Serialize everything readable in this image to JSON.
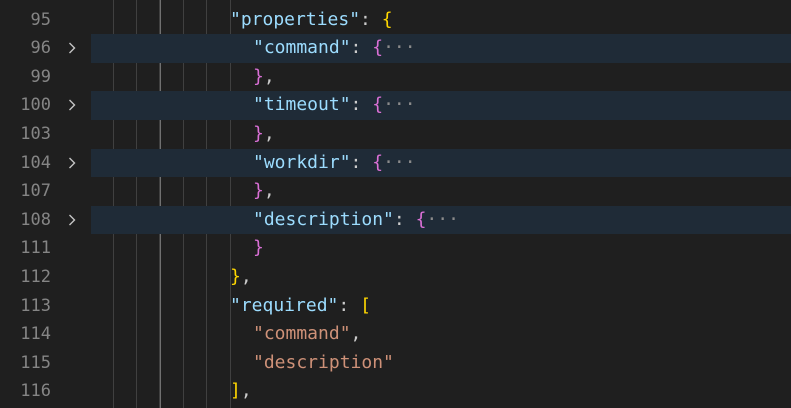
{
  "editor": {
    "lines": [
      {
        "num": "95",
        "folded": false,
        "indent": 230,
        "tokens": [
          {
            "t": "\"properties\"",
            "c": "k"
          },
          {
            "t": ": ",
            "c": "p"
          },
          {
            "t": "{",
            "c": "b1"
          }
        ]
      },
      {
        "num": "96",
        "folded": true,
        "indent": 253,
        "tokens": [
          {
            "t": "\"command\"",
            "c": "k"
          },
          {
            "t": ": ",
            "c": "p"
          },
          {
            "t": "{",
            "c": "b2"
          },
          {
            "t": "···",
            "c": "ell"
          }
        ]
      },
      {
        "num": "99",
        "folded": false,
        "indent": 253,
        "tokens": [
          {
            "t": "}",
            "c": "b2"
          },
          {
            "t": ",",
            "c": "p"
          }
        ]
      },
      {
        "num": "100",
        "folded": true,
        "indent": 253,
        "tokens": [
          {
            "t": "\"timeout\"",
            "c": "k"
          },
          {
            "t": ": ",
            "c": "p"
          },
          {
            "t": "{",
            "c": "b2"
          },
          {
            "t": "···",
            "c": "ell"
          }
        ]
      },
      {
        "num": "103",
        "folded": false,
        "indent": 253,
        "tokens": [
          {
            "t": "}",
            "c": "b2"
          },
          {
            "t": ",",
            "c": "p"
          }
        ]
      },
      {
        "num": "104",
        "folded": true,
        "indent": 253,
        "tokens": [
          {
            "t": "\"workdir\"",
            "c": "k"
          },
          {
            "t": ": ",
            "c": "p"
          },
          {
            "t": "{",
            "c": "b2"
          },
          {
            "t": "···",
            "c": "ell"
          }
        ]
      },
      {
        "num": "107",
        "folded": false,
        "indent": 253,
        "tokens": [
          {
            "t": "}",
            "c": "b2"
          },
          {
            "t": ",",
            "c": "p"
          }
        ]
      },
      {
        "num": "108",
        "folded": true,
        "indent": 253,
        "tokens": [
          {
            "t": "\"description\"",
            "c": "k"
          },
          {
            "t": ": ",
            "c": "p"
          },
          {
            "t": "{",
            "c": "b2"
          },
          {
            "t": "···",
            "c": "ell"
          }
        ]
      },
      {
        "num": "111",
        "folded": false,
        "indent": 253,
        "tokens": [
          {
            "t": "}",
            "c": "b2"
          }
        ]
      },
      {
        "num": "112",
        "folded": false,
        "indent": 230,
        "tokens": [
          {
            "t": "}",
            "c": "b1"
          },
          {
            "t": ",",
            "c": "p"
          }
        ]
      },
      {
        "num": "113",
        "folded": false,
        "indent": 230,
        "tokens": [
          {
            "t": "\"required\"",
            "c": "k"
          },
          {
            "t": ": ",
            "c": "p"
          },
          {
            "t": "[",
            "c": "b1"
          }
        ]
      },
      {
        "num": "114",
        "folded": false,
        "indent": 253,
        "tokens": [
          {
            "t": "\"command\"",
            "c": "s"
          },
          {
            "t": ",",
            "c": "p"
          }
        ]
      },
      {
        "num": "115",
        "folded": false,
        "indent": 253,
        "tokens": [
          {
            "t": "\"description\"",
            "c": "s"
          }
        ]
      },
      {
        "num": "116",
        "folded": false,
        "indent": 230,
        "tokens": [
          {
            "t": "]",
            "c": "b1"
          },
          {
            "t": ",",
            "c": "p"
          }
        ]
      }
    ],
    "fold_icon": "chevron-right-icon",
    "colors": {
      "background": "#1f1f1f",
      "folded_line": "#1f2b37",
      "property_key": "#9cdcfe",
      "string_value": "#ce9178",
      "bracket_level_1": "#ffd700",
      "bracket_level_2": "#da70d6",
      "line_number": "#858585"
    }
  }
}
